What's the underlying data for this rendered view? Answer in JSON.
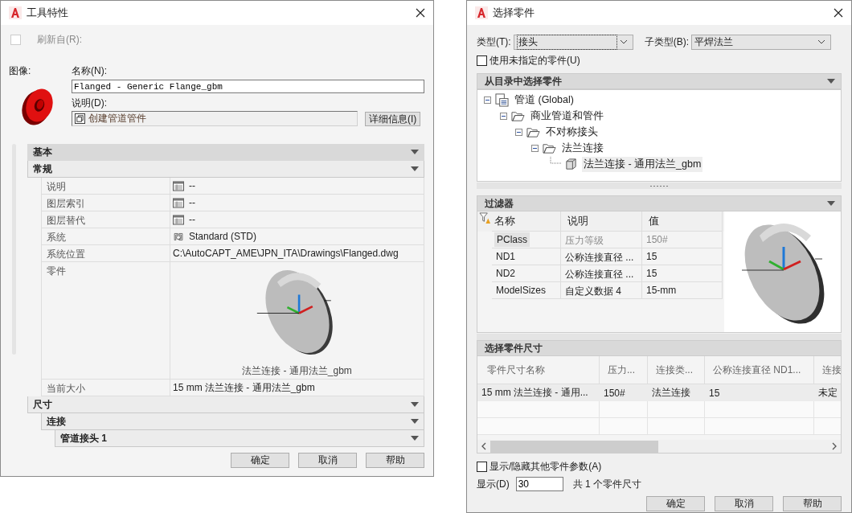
{
  "left_dialog": {
    "title": "工具特性",
    "refresh": {
      "label": "刷新自(R):",
      "checked": false,
      "disabled": true
    },
    "image_label": "图像:",
    "name_field": {
      "label": "名称(N):",
      "value": "Flanged - Generic Flange_gbm"
    },
    "description_field": {
      "label": "说明(D):",
      "value": "创建管道管件"
    },
    "details_button": "详细信息(I)",
    "categories": [
      {
        "label": "基本",
        "selected": true
      },
      {
        "label": "常规",
        "selected": false,
        "properties": [
          {
            "name": "说明",
            "value": "--",
            "kind": "table"
          },
          {
            "name": "图层索引",
            "value": "--",
            "kind": "table"
          },
          {
            "name": "图层替代",
            "value": "--",
            "kind": "table"
          },
          {
            "name": "系统",
            "value": "Standard (STD)",
            "kind": "system"
          },
          {
            "name": "系统位置",
            "value": "C:\\AutoCAPT_AME\\JPN_ITA\\Drawings\\Flanged.dwg",
            "kind": "text"
          },
          {
            "name": "零件",
            "value": "法兰连接 - 通用法兰_gbm",
            "kind": "preview"
          },
          {
            "name": "当前大小",
            "value": "15 mm 法兰连接 - 通用法兰_gbm",
            "kind": "text"
          }
        ]
      },
      {
        "label": "尺寸",
        "selected": false,
        "children": [
          {
            "label": "连接",
            "selected": false,
            "children": [
              {
                "label": "管道接头 1",
                "selected": false
              }
            ]
          }
        ]
      }
    ],
    "buttons": [
      "确定",
      "取消",
      "帮助"
    ]
  },
  "right_dialog": {
    "title": "选择零件",
    "type_select": {
      "label": "类型(T):",
      "value": "接头"
    },
    "subtype_select": {
      "label": "子类型(B):",
      "value": "平焊法兰"
    },
    "unspecified": {
      "label": "使用未指定的零件(U)",
      "checked": false
    },
    "catalog_section": "从目录中选择零件",
    "catalog_tree": [
      {
        "label": "管道 (Global)",
        "kind": "catalog",
        "selected": false,
        "children": [
          {
            "label": "商业管道和管件",
            "kind": "folder",
            "selected": false,
            "children": [
              {
                "label": "不对称接头",
                "kind": "folder",
                "selected": false,
                "children": [
                  {
                    "label": "法兰连接",
                    "kind": "folder",
                    "selected": false,
                    "children": [
                      {
                        "label": "法兰连接 - 通用法兰_gbm",
                        "kind": "part",
                        "selected": true
                      }
                    ]
                  }
                ]
              }
            ]
          }
        ]
      }
    ],
    "filter_section": "过滤器",
    "filter_table": {
      "columns": [
        "名称",
        "说明",
        "值"
      ],
      "rows": [
        {
          "cells": [
            "PClass",
            "压力等级",
            "150#"
          ],
          "selected": true,
          "disabled": true
        },
        {
          "cells": [
            "ND1",
            "公称连接直径 ...",
            "15"
          ],
          "selected": false,
          "disabled": false
        },
        {
          "cells": [
            "ND2",
            "公称连接直径 ...",
            "15"
          ],
          "selected": false,
          "disabled": false
        },
        {
          "cells": [
            "ModelSizes",
            "自定义数据 4",
            "15-mm"
          ],
          "selected": false,
          "disabled": false
        }
      ]
    },
    "sizes_section": "选择零件尺寸",
    "sizes_table": {
      "columns": [
        "零件尺寸名称",
        "压力...",
        "连接类...",
        "公称连接直径 ND1...",
        "连接"
      ],
      "rows": [
        [
          "15 mm 法兰连接 - 通用...",
          "150#",
          "法兰连接",
          "15",
          "未定"
        ]
      ]
    },
    "show_hide": {
      "label": "显示/隐藏其他零件参数(A)",
      "checked": false
    },
    "display": {
      "label": "显示(D)",
      "value": "30",
      "summary": "共 1 个零件尺寸"
    },
    "buttons": [
      "确定",
      "取消",
      "帮助"
    ]
  }
}
